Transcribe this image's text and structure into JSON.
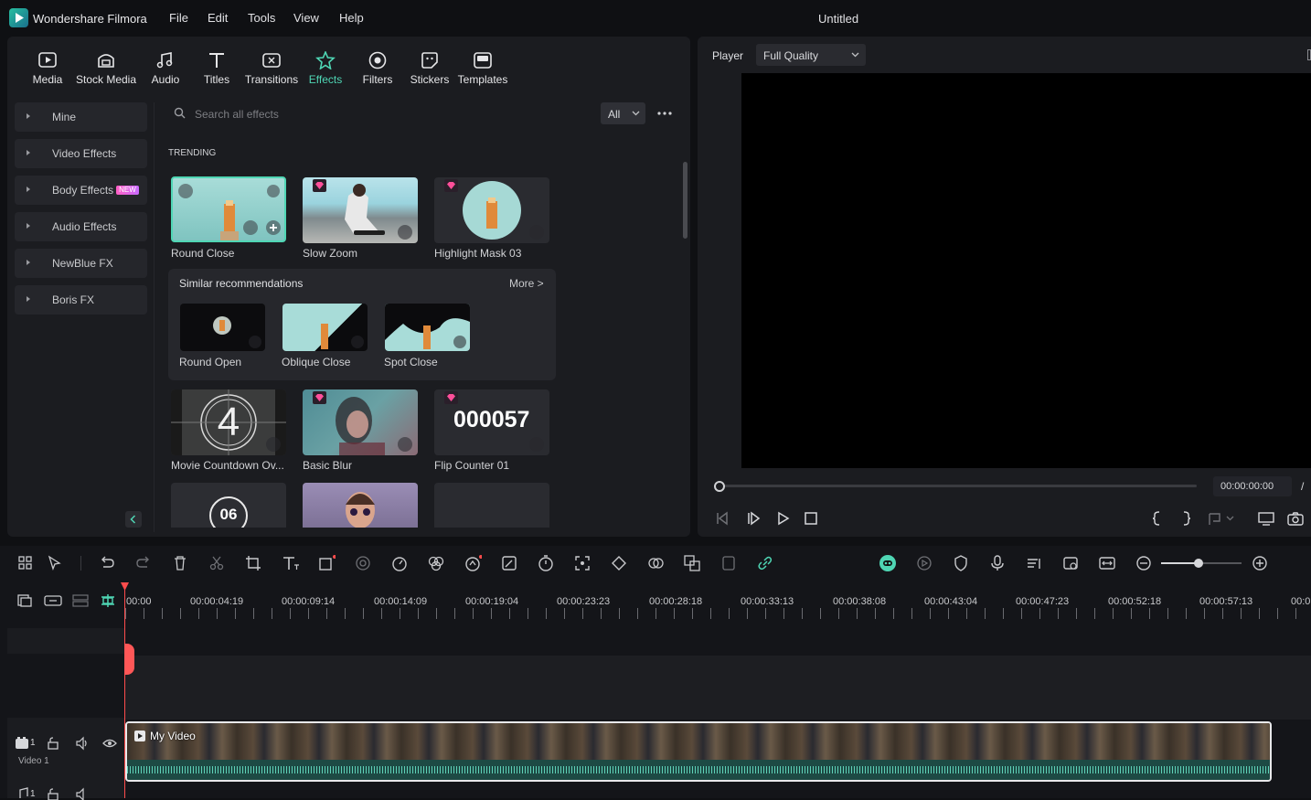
{
  "app": {
    "name": "Wondershare Filmora",
    "doc_title": "Untitled"
  },
  "menu": [
    "File",
    "Edit",
    "Tools",
    "View",
    "Help"
  ],
  "toolbar": {
    "items": [
      {
        "label": "Media",
        "icon": "media-icon"
      },
      {
        "label": "Stock Media",
        "icon": "stock-media-icon"
      },
      {
        "label": "Audio",
        "icon": "audio-icon"
      },
      {
        "label": "Titles",
        "icon": "titles-icon"
      },
      {
        "label": "Transitions",
        "icon": "transitions-icon"
      },
      {
        "label": "Effects",
        "icon": "effects-icon",
        "active": true
      },
      {
        "label": "Filters",
        "icon": "filters-icon"
      },
      {
        "label": "Stickers",
        "icon": "stickers-icon"
      },
      {
        "label": "Templates",
        "icon": "templates-icon"
      }
    ]
  },
  "categories": [
    "Mine",
    "Video Effects",
    "Body Effects",
    "Audio Effects",
    "NewBlue FX",
    "Boris FX"
  ],
  "new_badge": "NEW",
  "search": {
    "placeholder": "Search all effects",
    "filter": "All"
  },
  "section_trending": "TRENDING",
  "effects": {
    "row1": [
      "Round Close",
      "Slow Zoom",
      "Highlight Mask 03"
    ],
    "similar_title": "Similar recommendations",
    "similar_more": "More >",
    "similar": [
      "Round Open",
      "Oblique Close",
      "Spot Close"
    ],
    "row2": [
      "Movie Countdown Ov...",
      "Basic Blur",
      "Flip Counter 01"
    ],
    "countdown_number": "4",
    "flip_counter_digits": [
      "00",
      "00",
      "57"
    ],
    "row3_number": "06"
  },
  "player": {
    "label": "Player",
    "quality": "Full Quality",
    "timecode": "00:00:00:00",
    "separator": "/"
  },
  "timeline": {
    "ruler": [
      "00:00",
      "00:00:04:19",
      "00:00:09:14",
      "00:00:14:09",
      "00:00:19:04",
      "00:00:23:23",
      "00:00:28:18",
      "00:00:33:13",
      "00:00:38:08",
      "00:00:43:04",
      "00:00:47:23",
      "00:00:52:18",
      "00:00:57:13",
      "00:0"
    ],
    "track_video_label": "Video 1",
    "track_number": "1",
    "clip_title": "My Video"
  },
  "colors": {
    "accent": "#4fd6b4",
    "playhead": "#ff4c4c",
    "panel": "#1b1c20"
  }
}
